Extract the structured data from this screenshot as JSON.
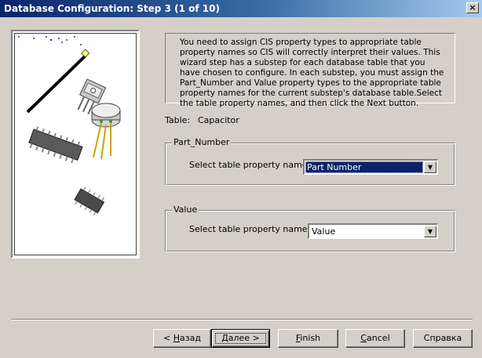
{
  "window": {
    "title": "Database Configuration: Step 3 (1 of 10)",
    "close_glyph": "×"
  },
  "info": {
    "text": "You need to assign CIS property types to appropriate table property names so CIS will correctly interpret their values. This wizard step has a substep for each database table that you have chosen to configure. In each substep, you must assign the Part_Number and Value property types to the appropriate table property names for the current substep's database table.Select the table property names, and then click the Next button."
  },
  "table": {
    "label": "Table:",
    "value": "Capacitor"
  },
  "part_number_group": {
    "legend": "Part_Number",
    "caption": "Select table property name",
    "selected": "Part Number"
  },
  "value_group": {
    "legend": "Value",
    "caption": "Select table property name",
    "selected": "Value"
  },
  "buttons": {
    "back": {
      "accel": "Н",
      "rest": "азад",
      "prefix": "< "
    },
    "next": {
      "accel": "Д",
      "rest": "алее >"
    },
    "finish": {
      "accel": "F",
      "rest": "inish"
    },
    "cancel": {
      "accel": "C",
      "rest": "ancel"
    },
    "help": "Справка"
  },
  "icons": {
    "dropdown": "chevron-down-icon",
    "illustration": "electronic-components-illustration"
  },
  "colors": {
    "title_start": "#0a246a",
    "title_end": "#a6caf0",
    "dialog_bg": "#d4d0c8",
    "selection": "#0a246a"
  }
}
